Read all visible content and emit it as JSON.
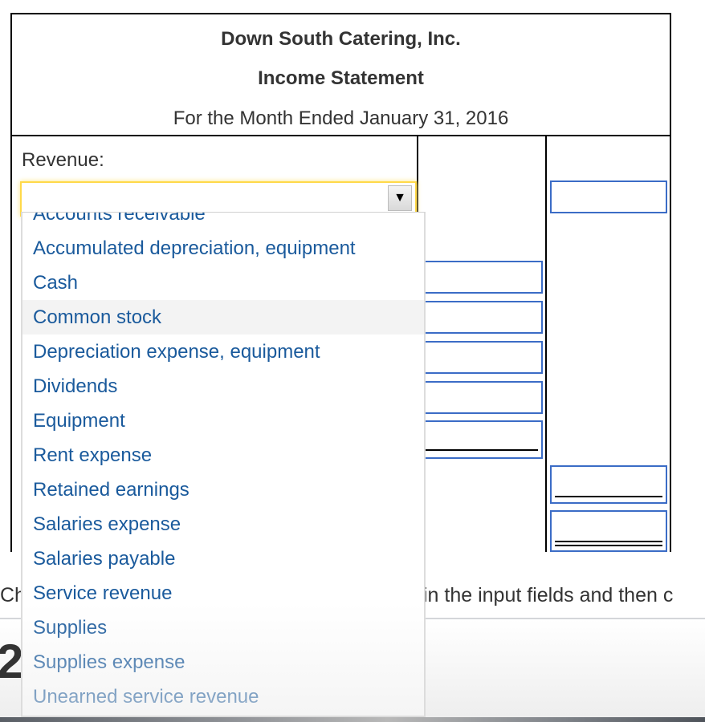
{
  "statement": {
    "company": "Down South Catering, Inc.",
    "title": "Income Statement",
    "period": "For the Month Ended January 31, 2016",
    "section_label": "Revenue:"
  },
  "revenue_select": {
    "selected_value": "",
    "open": true,
    "arrow_icon": "triangle-down-icon",
    "options": [
      "Accounts receivable",
      "Accumulated depreciation, equipment",
      "Cash",
      "Common stock",
      "Depreciation expense, equipment",
      "Dividends",
      "Equipment",
      "Rent expense",
      "Retained earnings",
      "Salaries expense",
      "Salaries payable",
      "Service revenue",
      "Supplies",
      "Supplies expense",
      "Unearned service revenue"
    ],
    "highlighted_option": "Common stock"
  },
  "amount_fields": {
    "revenue_total": "",
    "expense_1": "",
    "expense_2": "",
    "expense_3": "",
    "expense_4": "",
    "expense_5": "",
    "total_expenses": "",
    "net_income": ""
  },
  "instructions": {
    "left_fragment": "Ch",
    "right_fragment": "in the input fields and then c"
  },
  "step_number": "2",
  "colors": {
    "input_border": "#3b6cc6",
    "option_text": "#1a5a9c",
    "focus_glow": "#ffd94a"
  }
}
